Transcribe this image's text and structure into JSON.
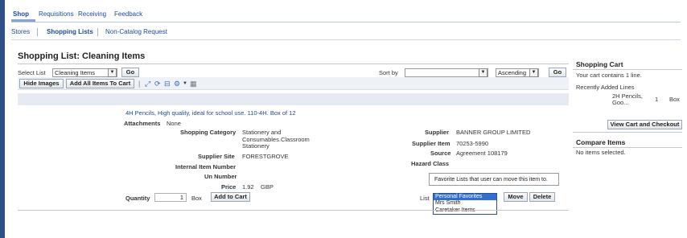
{
  "top_tabs": [
    {
      "label": "Shop",
      "active": true
    },
    {
      "label": "Requisitions",
      "active": false
    },
    {
      "label": "Receiving",
      "active": false
    },
    {
      "label": "Feedback",
      "active": false
    }
  ],
  "sub_tabs": [
    {
      "label": "Stores"
    },
    {
      "label": "Shopping Lists"
    },
    {
      "label": "Non-Catalog Request"
    }
  ],
  "page_title": "Shopping List: Cleaning Items",
  "controls": {
    "select_list_label": "Select List",
    "select_list_value": "Cleaning Items",
    "go_label": "Go",
    "sort_by_label": "Sort by",
    "sort_by_value": "",
    "sort_order_value": "Ascending",
    "go2_label": "Go"
  },
  "toolbar": {
    "hide_images_label": "Hide Images",
    "add_all_label": "Add All Items To Cart"
  },
  "item": {
    "description": "4H Pencils, High quality, ideal for school use. 110-4H. Box of 12",
    "attachments_label": "Attachments",
    "attachments_value": "None",
    "shopping_category_label": "Shopping Category",
    "shopping_category_value_1": "Stationery and",
    "shopping_category_value_2": "Consumables.Classroom",
    "shopping_category_value_3": "Stationery",
    "supplier_site_label": "Supplier Site",
    "supplier_site_value": "FORESTGROVE",
    "internal_item_label": "Internal Item Number",
    "un_number_label": "Un Number",
    "price_label": "Price",
    "price_value": "1.92",
    "price_currency": "GBP",
    "quantity_label": "Quantity",
    "quantity_value": "1",
    "uom": "Box",
    "add_to_cart_label": "Add to Cart",
    "supplier_label": "Supplier",
    "supplier_value": "BANNER GROUP LIMITED",
    "supplier_item_label": "Supplier Item",
    "supplier_item_value": "70253-5990",
    "source_label": "Source",
    "source_value": "Agreement 108179",
    "hazard_class_label": "Hazard Class",
    "list_label": "List",
    "move_label": "Move",
    "delete_label": "Delete"
  },
  "tooltip_text": "Favorite Lists that user can move this item to.",
  "list_options": [
    "Personal Favorites",
    "Mrs Smith",
    "Caretaker Items"
  ],
  "list_selected_index": 0,
  "cart": {
    "title": "Shopping Cart",
    "count_text": "Your cart contains 1 line.",
    "recent_label": "Recently Added Lines",
    "recent_item_1": "2H Pencils,",
    "recent_item_2": "Goo...",
    "recent_qty": "1",
    "recent_uom": "Box",
    "view_cart_label": "View Cart and Checkout"
  },
  "compare": {
    "title": "Compare Items",
    "text": "No items selected."
  },
  "colors": {
    "accent": "#1e4b8f",
    "sidebar": "#2f4f86",
    "selection": "#2f6fd0"
  }
}
